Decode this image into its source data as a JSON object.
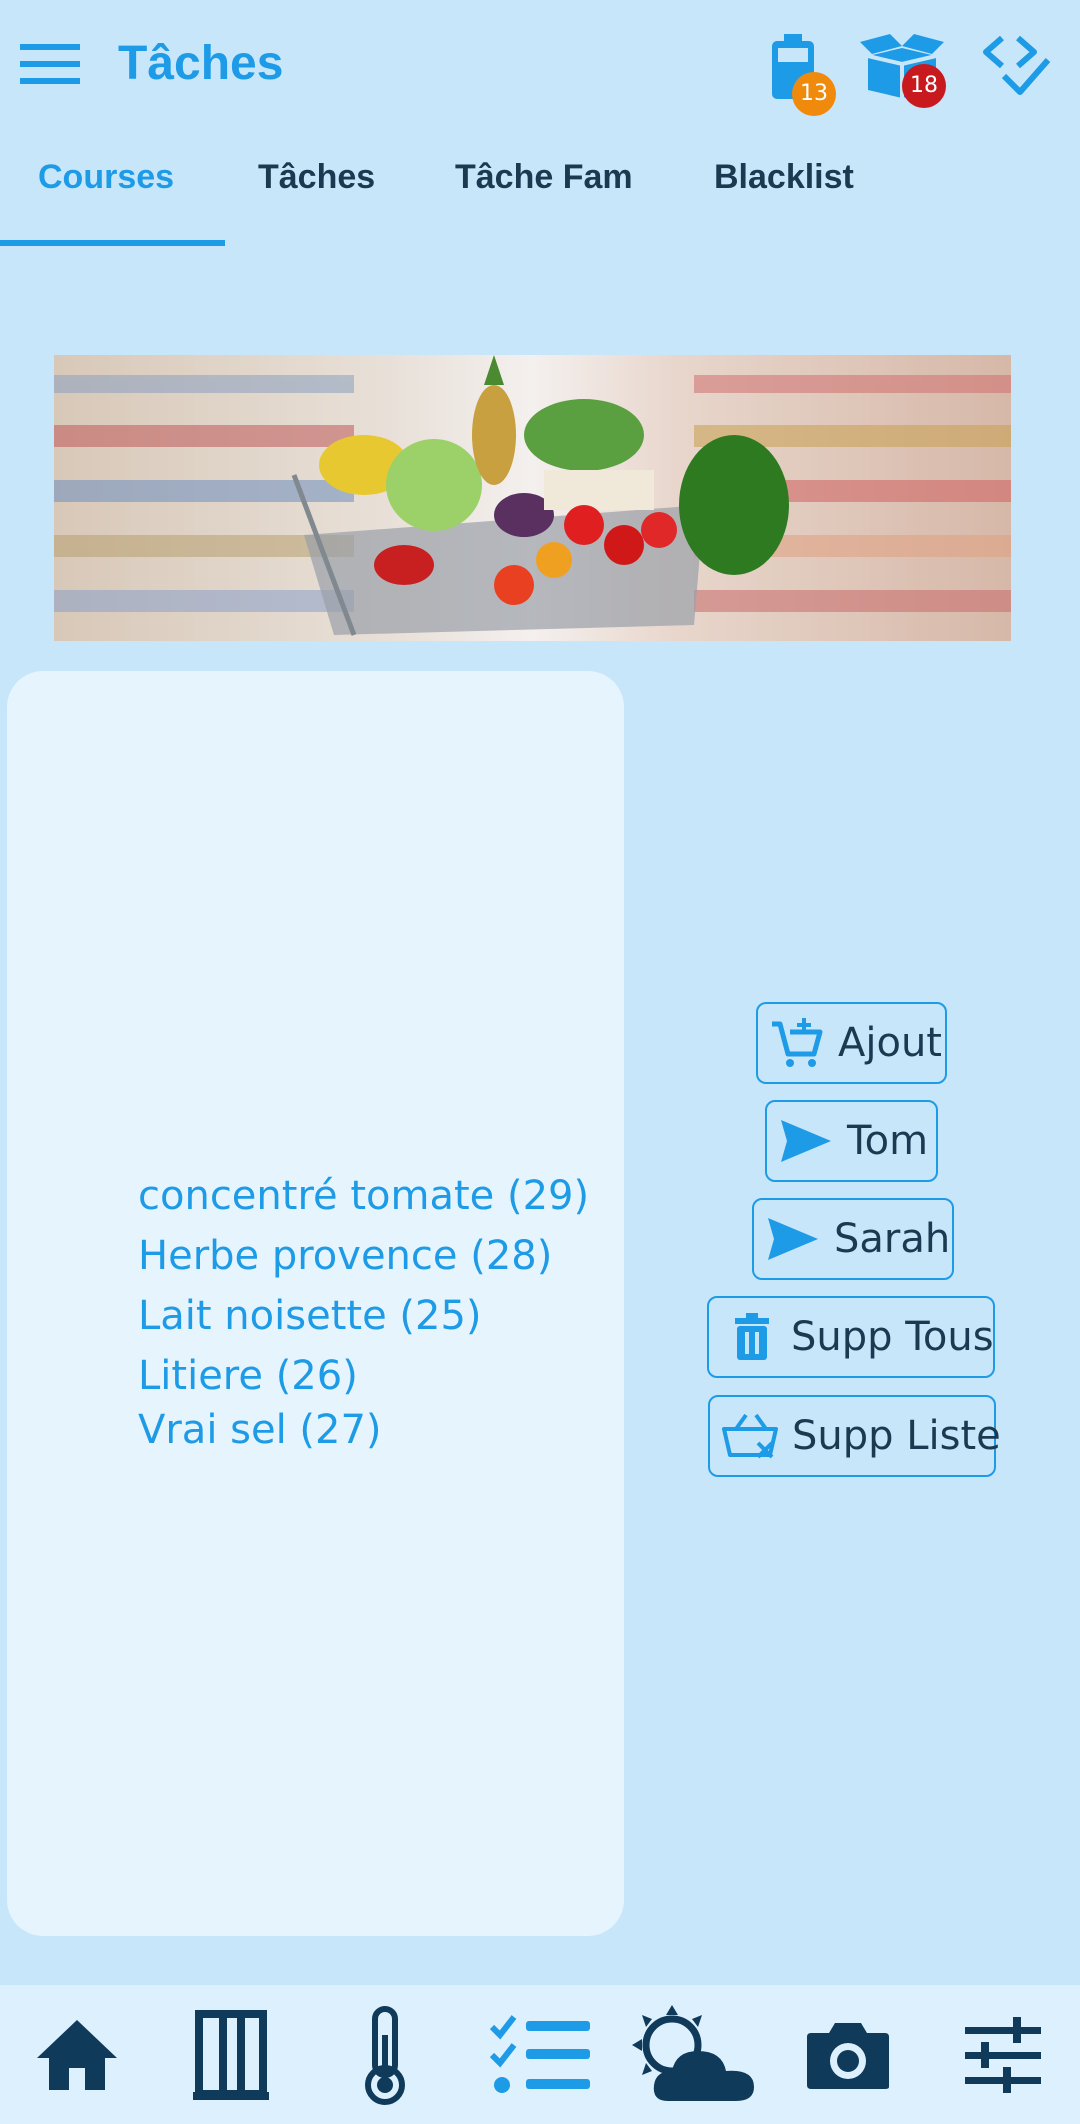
{
  "header": {
    "title": "Tâches",
    "icons": [
      "menu-icon",
      "battery-icon",
      "open-box-icon",
      "code-check-icon"
    ],
    "battery_badge": "13",
    "box_badge": "18",
    "colors": {
      "accent": "#1e9be6",
      "battery_badge": "#f08a0c",
      "box_badge": "#c8191e",
      "background": "#c8e6fa"
    }
  },
  "tabs": [
    {
      "label": "Courses",
      "active": true
    },
    {
      "label": "Tâches",
      "active": false
    },
    {
      "label": "Tâche Fam",
      "active": false
    },
    {
      "label": "Blacklist",
      "active": false
    }
  ],
  "shopping_list": {
    "items": [
      "concentré tomate (29)",
      "Herbe provence (28)",
      "Lait noisette (25)",
      "Litiere (26)",
      "Vrai sel (27)"
    ]
  },
  "actions": {
    "add": {
      "label": "Ajout",
      "icon": "cart-plus-icon"
    },
    "send_tom": {
      "label": "Tom",
      "icon": "send-icon"
    },
    "send_sarah": {
      "label": "Sarah",
      "icon": "send-icon"
    },
    "delete_all": {
      "label": "Supp Tous",
      "icon": "trash-icon"
    },
    "delete_list": {
      "label": "Supp Liste",
      "icon": "basket-remove-icon"
    }
  },
  "bottom_nav": [
    "home-icon",
    "door-icon",
    "thermometer-icon",
    "checklist-icon",
    "weather-icon",
    "camera-icon",
    "sliders-icon"
  ]
}
